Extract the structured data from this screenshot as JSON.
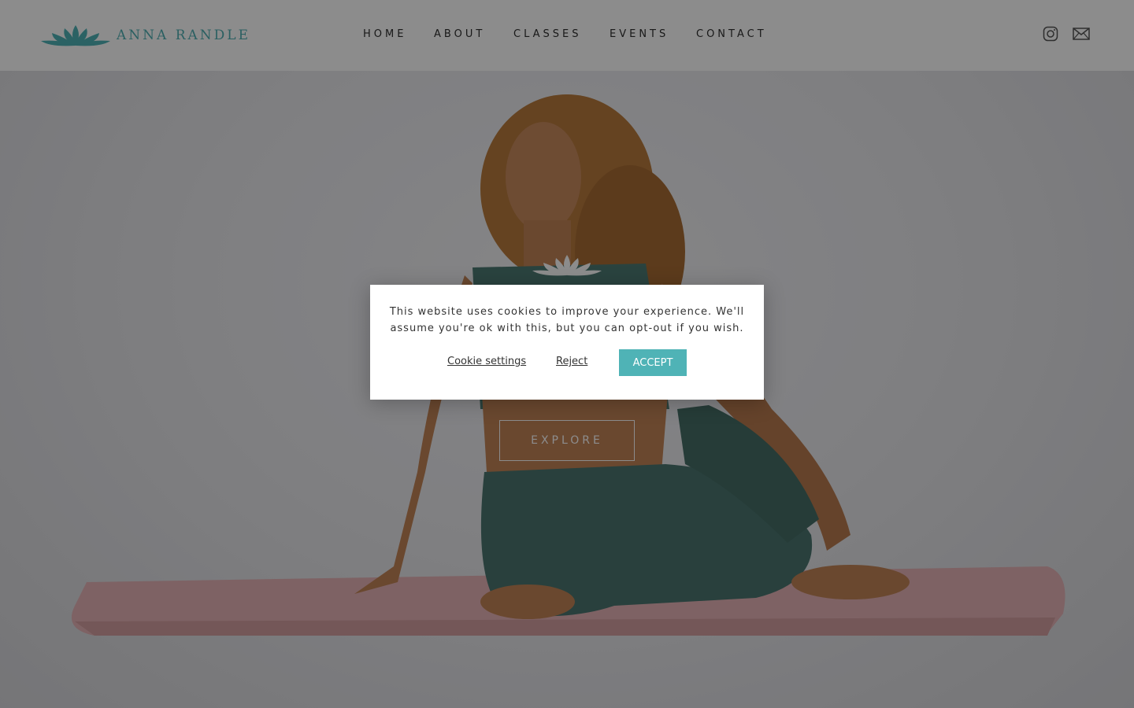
{
  "brand": {
    "name": "ANNA RANDLE",
    "accent_color": "#4fb3b6",
    "logo_icon": "lotus-icon"
  },
  "nav": {
    "items": [
      "HOME",
      "ABOUT",
      "CLASSES",
      "EVENTS",
      "CONTACT"
    ]
  },
  "social": {
    "icons": [
      "instagram-icon",
      "mail-icon"
    ]
  },
  "hero": {
    "icon": "lotus-icon",
    "button_label": "EXPLORE"
  },
  "cookie": {
    "message": "This website uses cookies to improve your experience. We'll assume you're ok with this, but you can opt-out if you wish.",
    "settings_label": "Cookie settings",
    "reject_label": "Reject",
    "accept_label": "ACCEPT"
  }
}
